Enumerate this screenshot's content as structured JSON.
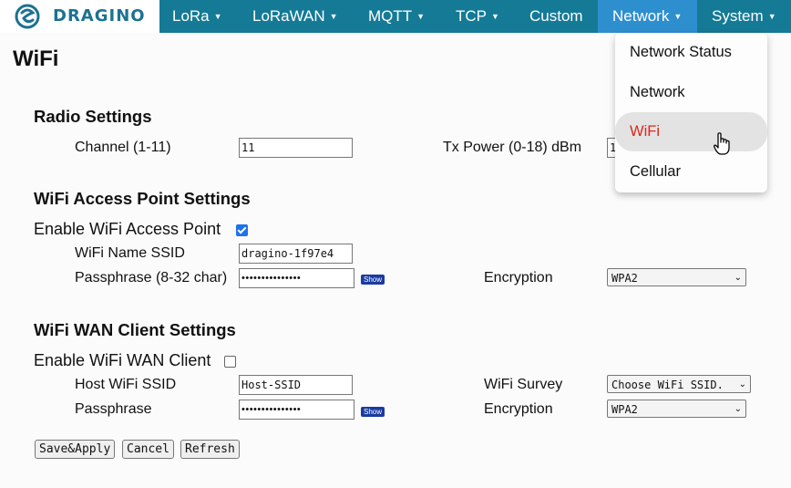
{
  "brand": {
    "name": "DRAGINO"
  },
  "nav": [
    {
      "label": "LoRa",
      "caret": true
    },
    {
      "label": "LoRaWAN",
      "caret": true
    },
    {
      "label": "MQTT",
      "caret": true
    },
    {
      "label": "TCP",
      "caret": true
    },
    {
      "label": "Custom",
      "caret": false
    },
    {
      "label": "Network",
      "caret": true,
      "active": true
    },
    {
      "label": "System",
      "caret": true
    }
  ],
  "dropdown": {
    "items": [
      {
        "label": "Network Status"
      },
      {
        "label": "Network"
      },
      {
        "label": "WiFi",
        "highlighted": true
      },
      {
        "label": "Cellular"
      }
    ]
  },
  "page": {
    "title": "WiFi"
  },
  "radio": {
    "title": "Radio Settings",
    "channel_label": "Channel (1-11)",
    "channel_value": "11",
    "txpower_label": "Tx Power (0-18) dBm",
    "txpower_value": "1"
  },
  "ap": {
    "title": "WiFi Access Point Settings",
    "enable_label": "Enable WiFi Access Point",
    "enabled": true,
    "ssid_label": "WiFi Name SSID",
    "ssid_value": "dragino-1f97e4",
    "pass_label": "Passphrase (8-32 char)",
    "pass_masked": "•••••••••••••••",
    "show_label": "Show",
    "enc_label": "Encryption",
    "enc_value": "WPA2"
  },
  "wan": {
    "title": "WiFi WAN Client Settings",
    "enable_label": "Enable WiFi WAN Client",
    "enabled": false,
    "ssid_label": "Host WiFi SSID",
    "ssid_value": "Host-SSID",
    "survey_label": "WiFi Survey",
    "survey_value": "Choose WiFi SSID.",
    "pass_label": "Passphrase",
    "pass_masked": "•••••••••••••••",
    "show_label": "Show",
    "enc_label": "Encryption",
    "enc_value": "WPA2"
  },
  "actions": {
    "save": "Save&Apply",
    "cancel": "Cancel",
    "refresh": "Refresh"
  },
  "colors": {
    "topbar": "#157a96",
    "active_nav": "#2e8fcf",
    "highlight_text": "#e0251b",
    "show_button": "#1a3ba0"
  },
  "icons": {
    "logo": "dragino-logo-icon",
    "caret": "caret-down-icon",
    "cursor": "hand-pointer-icon",
    "select": "chevron-down-icon"
  }
}
